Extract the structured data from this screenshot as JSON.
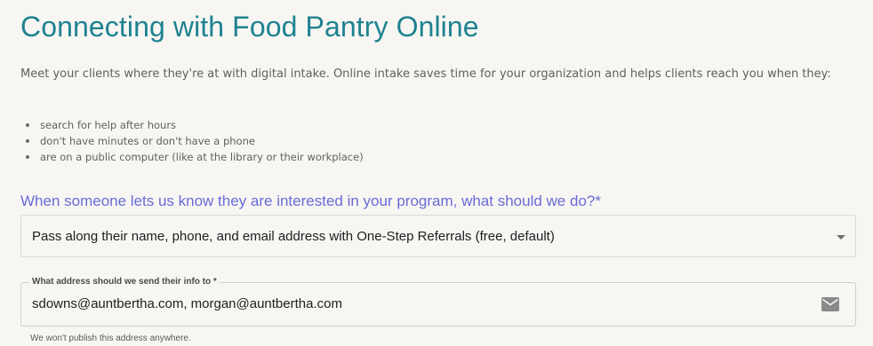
{
  "page": {
    "title": "Connecting with Food Pantry Online",
    "intro": "Meet your clients where they're at with digital intake. Online intake saves time for your organization and helps clients reach you when they:",
    "bullets": [
      "search for help after hours",
      "don't have minutes or don't have a phone",
      "are on a public computer (like at the library or their workplace)"
    ]
  },
  "referral": {
    "question": "When someone lets us know they are interested in your program, what should we do?*",
    "selected_option": "Pass along their name, phone, and email address with One-Step Referrals (free, default)"
  },
  "email_field": {
    "label": "What address should we send their info to *",
    "value": "sdowns@auntbertha.com, morgan@auntbertha.com",
    "icon": "mail-icon",
    "helper": "We won't publish this address anywhere."
  },
  "colors": {
    "title": "#1f8290",
    "question": "#6a6bd6",
    "background": "#f7f6f3",
    "body_text": "#5f5f5f"
  }
}
